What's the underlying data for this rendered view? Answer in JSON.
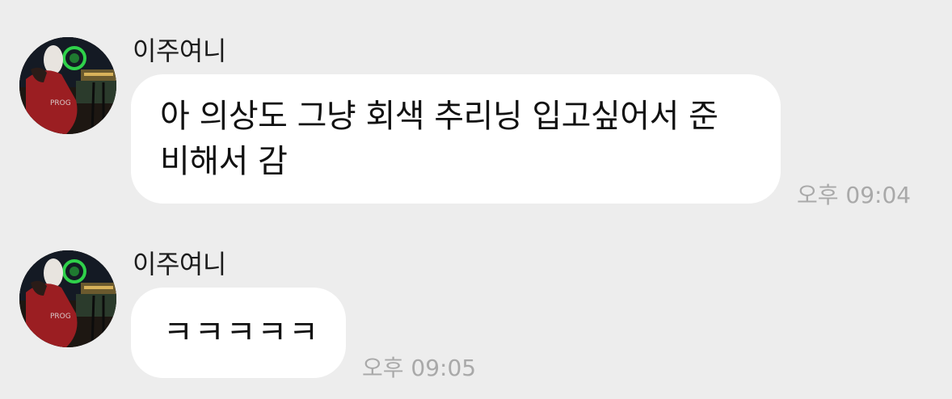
{
  "messages": [
    {
      "sender": "이주여니",
      "lines": [
        "아 의상도 그냥 회색 추리닝 입고싶어서 준",
        "비해서 감"
      ],
      "time": "오후 09:04"
    },
    {
      "sender": "이주여니",
      "lines": [
        "ㅋㅋㅋㅋㅋ"
      ],
      "time": "오후 09:05"
    }
  ],
  "colors": {
    "background": "#ededed",
    "bubble": "#ffffff",
    "time_text": "#a9a9a9"
  },
  "icons": {
    "avatar": "profile-photo-icon"
  }
}
